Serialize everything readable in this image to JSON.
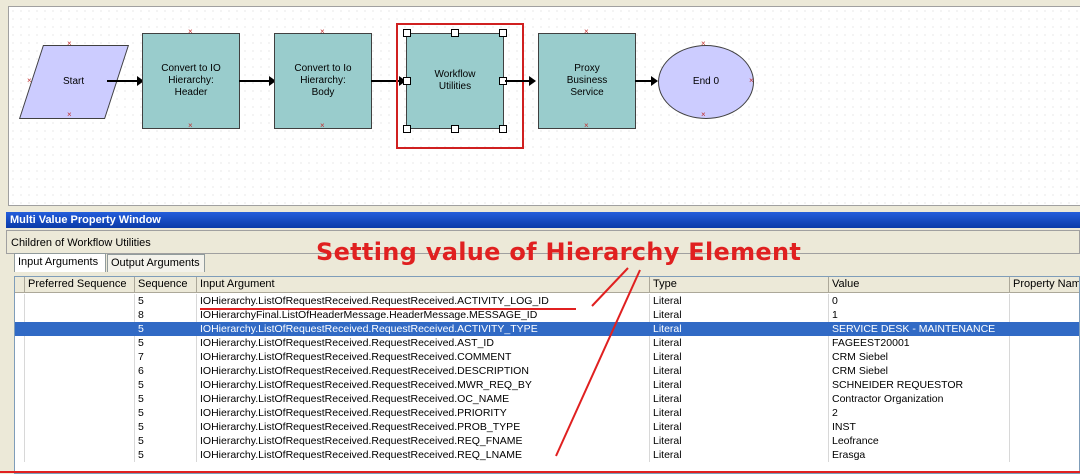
{
  "workflow": {
    "nodes": [
      {
        "id": "start",
        "label": "Start"
      },
      {
        "id": "convert-header",
        "label": "Convert to IO Hierarchy: Header"
      },
      {
        "id": "convert-body",
        "label": "Convert to Io Hierarchy: Body"
      },
      {
        "id": "workflow-utilities",
        "label": "Workflow Utilities"
      },
      {
        "id": "proxy-bs",
        "label": "Proxy Business Service"
      },
      {
        "id": "end",
        "label": "End 0"
      }
    ]
  },
  "panel": {
    "title": "Multi Value Property Window",
    "children_label": "Children of Workflow Utilities",
    "tabs": [
      {
        "label": "Input Arguments",
        "active": true
      },
      {
        "label": "Output Arguments",
        "active": false
      }
    ]
  },
  "annotation": "Setting value of Hierarchy Element",
  "table": {
    "columns": [
      "Preferred Sequence",
      "Sequence",
      "Input Argument",
      "Type",
      "Value",
      "Property Nam"
    ],
    "rows": [
      {
        "seq": "5",
        "arg": "IOHierarchy.ListOfRequestReceived.RequestReceived.ACTIVITY_LOG_ID",
        "type": "Literal",
        "value": "0"
      },
      {
        "seq": "8",
        "arg": "IOHierarchyFinal.ListOfHeaderMessage.HeaderMessage.MESSAGE_ID",
        "type": "Literal",
        "value": "1"
      },
      {
        "seq": "5",
        "arg": "IOHierarchy.ListOfRequestReceived.RequestReceived.ACTIVITY_TYPE",
        "type": "Literal",
        "value": "SERVICE DESK - MAINTENANCE",
        "selected": true
      },
      {
        "seq": "5",
        "arg": "IOHierarchy.ListOfRequestReceived.RequestReceived.AST_ID",
        "type": "Literal",
        "value": "FAGEEST20001"
      },
      {
        "seq": "7",
        "arg": "IOHierarchy.ListOfRequestReceived.RequestReceived.COMMENT",
        "type": "Literal",
        "value": "CRM Siebel"
      },
      {
        "seq": "6",
        "arg": "IOHierarchy.ListOfRequestReceived.RequestReceived.DESCRIPTION",
        "type": "Literal",
        "value": "CRM Siebel"
      },
      {
        "seq": "5",
        "arg": "IOHierarchy.ListOfRequestReceived.RequestReceived.MWR_REQ_BY",
        "type": "Literal",
        "value": "SCHNEIDER REQUESTOR"
      },
      {
        "seq": "5",
        "arg": "IOHierarchy.ListOfRequestReceived.RequestReceived.OC_NAME",
        "type": "Literal",
        "value": "Contractor Organization"
      },
      {
        "seq": "5",
        "arg": "IOHierarchy.ListOfRequestReceived.RequestReceived.PRIORITY",
        "type": "Literal",
        "value": "2"
      },
      {
        "seq": "5",
        "arg": "IOHierarchy.ListOfRequestReceived.RequestReceived.PROB_TYPE",
        "type": "Literal",
        "value": "INST"
      },
      {
        "seq": "5",
        "arg": "IOHierarchy.ListOfRequestReceived.RequestReceived.REQ_FNAME",
        "type": "Literal",
        "value": "Leofrance"
      },
      {
        "seq": "5",
        "arg": "IOHierarchy.ListOfRequestReceived.RequestReceived.REQ_LNAME",
        "type": "Literal",
        "value": "Erasga"
      }
    ]
  },
  "colors": {
    "step": "#99cccc",
    "terminal": "#ccccff",
    "selection": "#d02020",
    "selected_row": "#316ac5",
    "annotation": "#e02020"
  }
}
